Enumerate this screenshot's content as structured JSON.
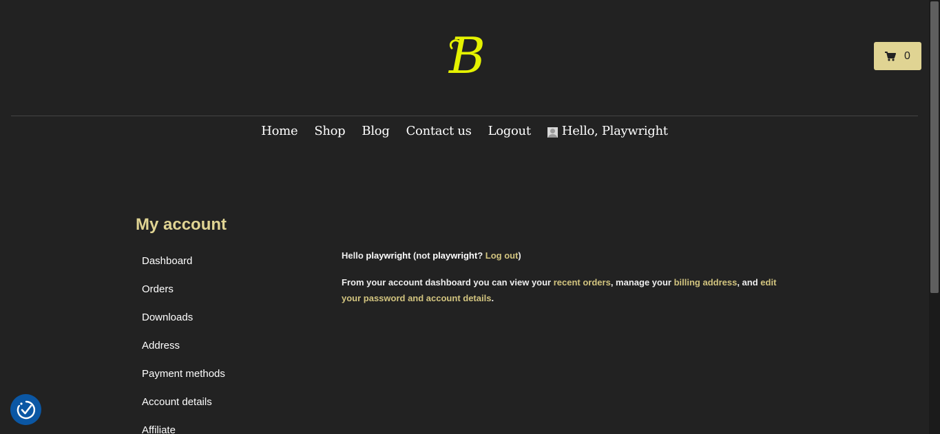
{
  "header": {
    "logo_letter": "B",
    "cart_count": "0",
    "colors": {
      "logo": "#e5f200",
      "accent": "#e0d493",
      "link": "#d2c47f",
      "background": "#222222"
    }
  },
  "nav": {
    "home": "Home",
    "shop": "Shop",
    "blog": "Blog",
    "contact": "Contact us",
    "logout": "Logout",
    "greeting": "Hello, Playwright"
  },
  "account": {
    "title": "My account",
    "menu": [
      "Dashboard",
      "Orders",
      "Downloads",
      "Address",
      "Payment methods",
      "Account details",
      "Affiliate"
    ]
  },
  "dashboard": {
    "hello_prefix": "Hello ",
    "username": "playwright",
    "not_prefix": " (not ",
    "username2": "playwright",
    "question": "? ",
    "logout_link": "Log out",
    "close_paren": ")",
    "intro": "From your account dashboard you can view your ",
    "recent_orders": "recent orders",
    "manage": ", manage your ",
    "billing_address": "billing address",
    "and": ", and ",
    "edit_details": "edit your password and account details",
    "period": "."
  },
  "icons": {
    "cart": "cart-icon",
    "user": "user-avatar-icon",
    "accessibility": "accessibility-check-icon"
  }
}
